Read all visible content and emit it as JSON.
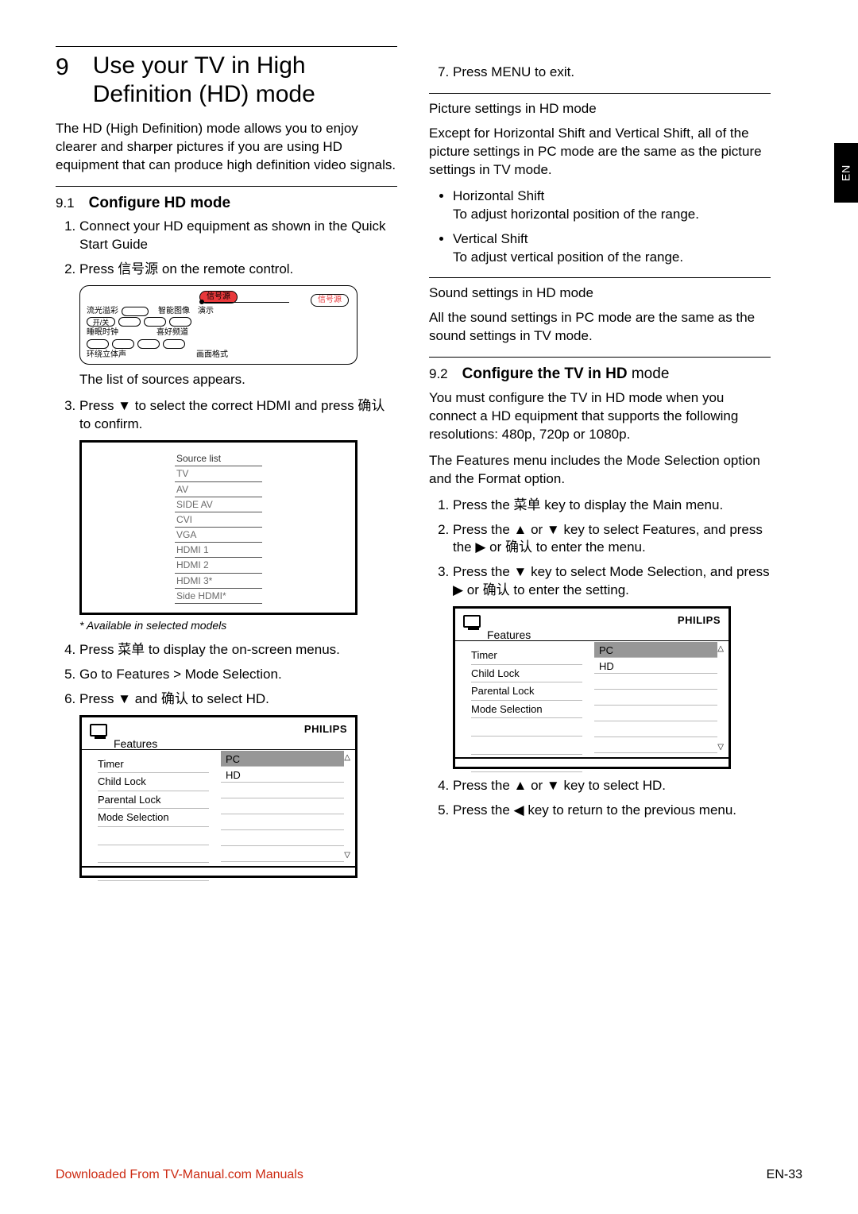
{
  "side_tab": "EN",
  "chapter": {
    "num": "9",
    "title": "Use your TV in High Definition (HD) mode"
  },
  "intro": "The HD (High Definition) mode allows you to enjoy clearer and sharper pictures if you are using HD equipment that can produce high definition video signals.",
  "s91": {
    "num": "9.1",
    "title": "Configure HD mode",
    "step1": "Connect your HD equipment as shown in the Quick Start Guide",
    "step2a": "Press ",
    "step2b": "信号源",
    "step2c": " on the remote control.",
    "remote": {
      "btn_source": "信号源",
      "row1_l": "流光溢彩",
      "row1_m": "智能图像",
      "row1_r": "演示",
      "pill_on_off": "开/关",
      "row2_l": "睡眠时钟",
      "row2_r": "喜好频道",
      "row3_l": "环绕立体声",
      "row3_r": "画面格式",
      "callout": "信号源"
    },
    "after_remote": "The list of sources appears.",
    "step3a": "Press ▼ to select the correct HDMI and press ",
    "step3b": "确认",
    "step3c": " to confirm.",
    "source_list": [
      "Source list",
      "TV",
      "AV",
      "SIDE AV",
      "CVI",
      "VGA",
      "HDMI 1",
      "HDMI 2",
      "HDMI 3*",
      "Side HDMI*"
    ],
    "note": "* Available in selected models",
    "step4a": "Press ",
    "step4b": "菜单",
    "step4c": " to display the on-screen menus.",
    "step5a": "Go to ",
    "step5b": "Features > Mode Selection",
    "step5c": ".",
    "step6a": "Press ▼ and ",
    "step6b": "确认",
    "step6c": " to select ",
    "step6d": "HD",
    "step6e": "."
  },
  "osd": {
    "brand": "PHILIPS",
    "menu_title": "Features",
    "left": [
      "Timer",
      "Child Lock",
      "Parental Lock",
      "Mode Selection"
    ],
    "right": [
      "PC",
      "HD"
    ]
  },
  "right": {
    "step7a": "Press ",
    "step7b": "MENU",
    "step7c": " to exit.",
    "pic_head": "Picture settings in HD mode",
    "pic_body": "Except for Horizontal Shift and Vertical Shift, all of the picture settings in PC mode are the same as the picture settings in TV mode.",
    "hs_t": "Horizontal Shift",
    "hs_d": "To adjust horizontal position of the range.",
    "vs_t": "Vertical Shift",
    "vs_d": "To adjust vertical position of the range.",
    "snd_head": "Sound settings in HD mode",
    "snd_body": "All the sound settings in PC mode are the same as the sound settings in TV mode."
  },
  "s92": {
    "num": "9.2",
    "title_bold": "Configure the TV in HD",
    "title_light": "mode",
    "p1": "You must configure the TV in HD mode when you connect a HD equipment that supports the following resolutions: 480p, 720p or 1080p.",
    "p2a": "The ",
    "p2b": "Features",
    "p2c": " menu includes the ",
    "p2d": "Mode Selection",
    "p2e": " option and the ",
    "p2f": "Format",
    "p2g": " option.",
    "st1a": "Press the ",
    "st1b": "菜单",
    "st1c": " key to display the ",
    "st1d": "Main",
    "st1e": " menu.",
    "st2a": "Press the ▲ or ▼ key to select ",
    "st2b": "Features",
    "st2c": ", and press the ▶ or ",
    "st2d": "确认",
    "st2e": " to enter the menu.",
    "st3a": "Press  the ▼ key to select ",
    "st3b": "Mode Selection",
    "st3c": ", and press ▶ or ",
    "st3d": "确认",
    "st3e": " to enter the setting.",
    "st4a": "Press the ▲ or ▼ key to select ",
    "st4b": "HD",
    "st4c": ".",
    "st5": "Press the ◀ key to return to the previous menu."
  },
  "footer": {
    "dl": "Downloaded From TV-Manual.com Manuals",
    "pg": "EN-33"
  }
}
